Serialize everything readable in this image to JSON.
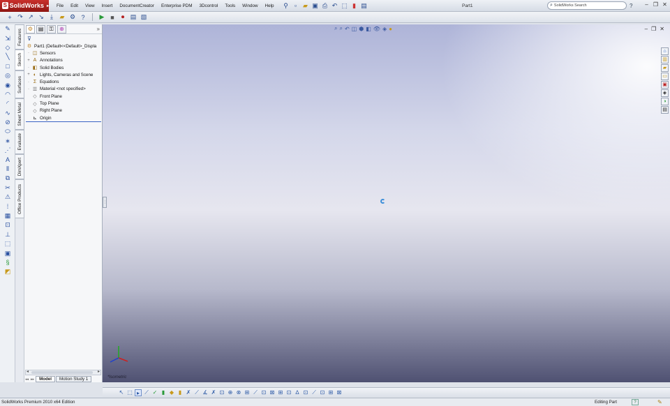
{
  "app": {
    "logo_text": "SolidWorks",
    "document_title": "Part1"
  },
  "menu": [
    "File",
    "Edit",
    "View",
    "Insert",
    "DocumentCreator",
    "Enterprise PDM",
    "3Dcontrol",
    "Tools",
    "Window",
    "Help"
  ],
  "search": {
    "placeholder": "SolidWorks Search"
  },
  "vertical_tabs": [
    "Features",
    "Sketch",
    "Surfaces",
    "Sheet Metal",
    "Evaluate",
    "DimXpert",
    "Office Products"
  ],
  "feature_tree": {
    "root": "Part1  (Default<<Default>_Displa",
    "items": [
      {
        "label": "Sensors",
        "icon": "sensor-icon"
      },
      {
        "label": "Annotations",
        "icon": "annotation-icon"
      },
      {
        "label": "Solid Bodies",
        "icon": "solid-bodies-icon"
      },
      {
        "label": "Lights, Cameras and Scene",
        "icon": "lights-icon"
      },
      {
        "label": "Equations",
        "icon": "equations-icon"
      },
      {
        "label": "Material <not specified>",
        "icon": "material-icon"
      },
      {
        "label": "Front Plane",
        "icon": "plane-icon"
      },
      {
        "label": "Top Plane",
        "icon": "plane-icon"
      },
      {
        "label": "Right Plane",
        "icon": "plane-icon"
      },
      {
        "label": "Origin",
        "icon": "origin-icon"
      }
    ]
  },
  "bottom_tabs": {
    "model": "Model",
    "motion": "Motion Study 1"
  },
  "viewport": {
    "view_label": "*Isometric"
  },
  "status": {
    "edition": "SolidWorks Premium 2010 x64 Edition",
    "state": "Editing Part"
  },
  "colors": {
    "accent": "#3a62c4",
    "logo": "#b52222",
    "origin_x": "#cc2020",
    "origin_y": "#22aa22",
    "origin_z": "#2040cc"
  }
}
